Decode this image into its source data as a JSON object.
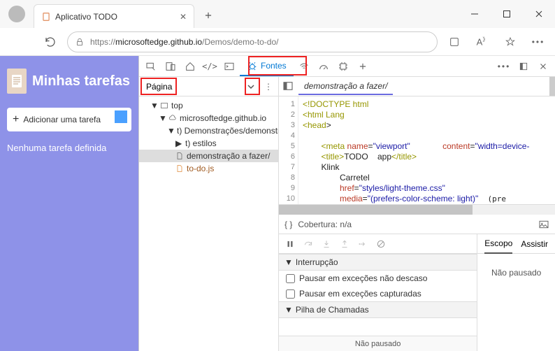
{
  "window": {
    "tab_title": "Aplicativo TODO"
  },
  "url": {
    "host": "microsoftedge.github.io",
    "path": "/Demos/demo-to-do/",
    "prefix": "https://"
  },
  "app": {
    "title": "Minhas tarefas",
    "add_label": "Adicionar uma tarefa",
    "empty_text": "Nenhuma tarefa definida"
  },
  "devtools": {
    "active_tab": "Fontes",
    "page_tab": "Página",
    "tree": {
      "top": "top",
      "domain": "microsoftedge.github.io",
      "demo_folder": "t) Demonstrações/demonstração a fazer",
      "styles_folder": "t) estilos",
      "html_file": "demonstração a fazer/",
      "js_file": "to-do.js"
    },
    "open_file": "demonstração a fazer/",
    "coverage_label": "Cobertura: n/a",
    "scope_tab": "Escopo",
    "watch_tab": "Assistir",
    "not_paused": "Não pausado",
    "breakpoints_hdr": "Interrupção",
    "pause_uncaught": "Pausar em exceções não descaso",
    "pause_caught": "Pausar em exceções capturadas",
    "callstack_hdr": "Pilha de Chamadas",
    "code_lines": {
      "l1": "<!DOCTYPE html",
      "l2": "<html Lang",
      "l3a": "<head",
      "l3b": ">",
      "l5a": "<meta",
      "l5b": " name",
      "l5c": "=",
      "l5d": "\"viewport\"",
      "l5e": "content",
      "l5f": "=",
      "l5g": "\"width=device-",
      "l6a": "<title>",
      "l6b": "TODO    app",
      "l6c": "</title>",
      "l7": "Klink",
      "l8": "Carretel",
      "l9a": "href",
      "l9b": "=",
      "l9c": "\"styles/light-theme.css\"",
      "l10a": "media",
      "l10b": "=",
      "l10c": "\"(prefers-color-scheme: light)\""
    }
  }
}
